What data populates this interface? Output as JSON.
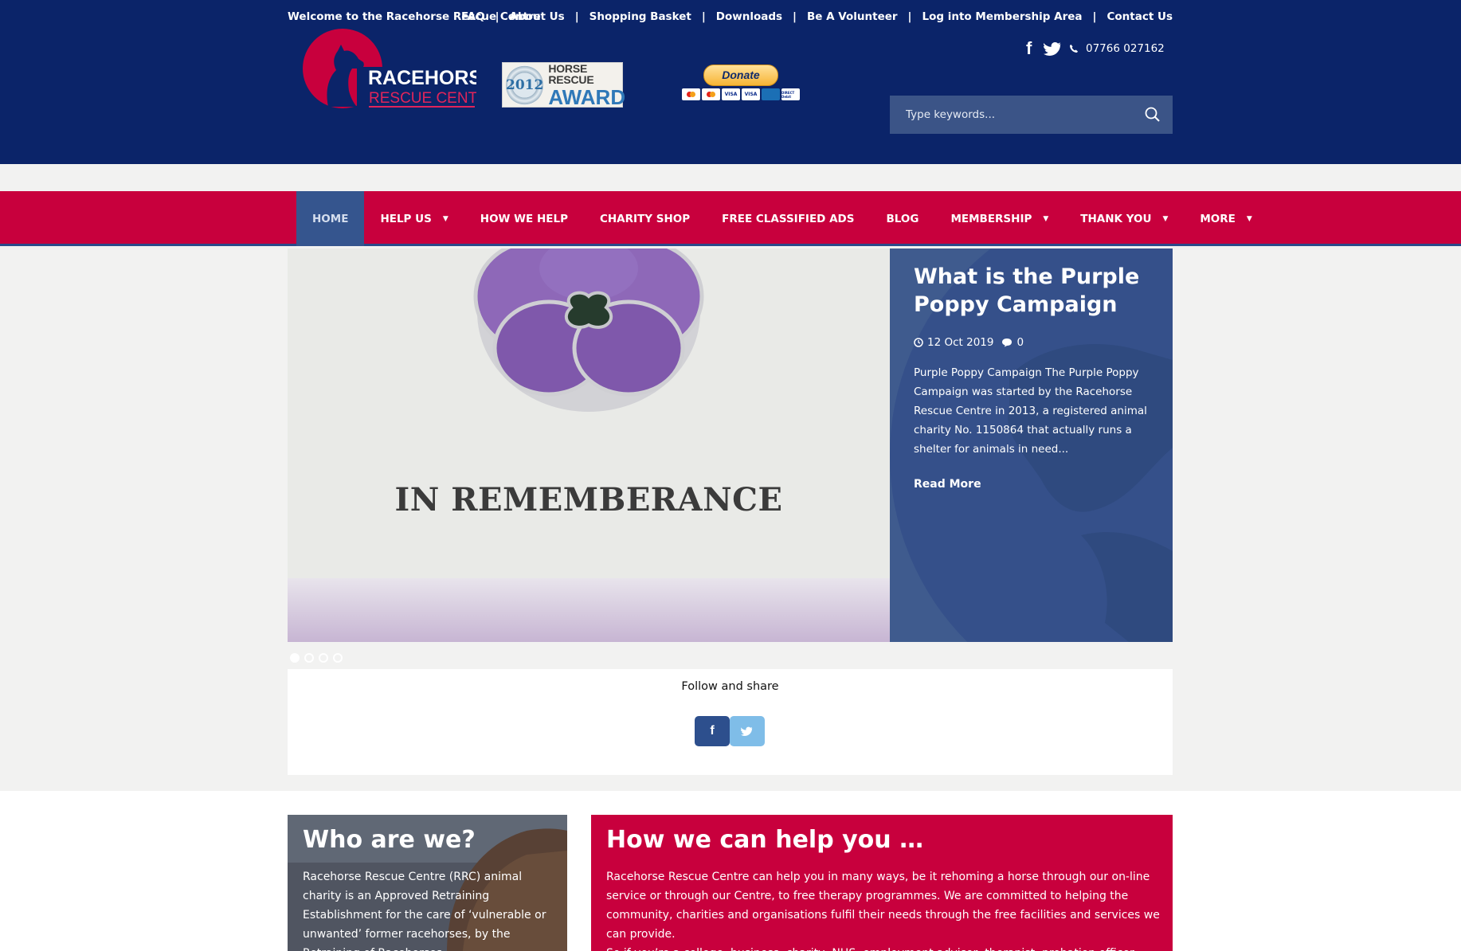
{
  "header": {
    "welcome": "Welcome to the Racehorse Rescue Centre",
    "links": [
      "FAQ",
      "About Us",
      "Shopping Basket",
      "Downloads",
      "Be A Volunteer",
      "Log into Membership Area",
      "Contact Us"
    ],
    "separator": "|",
    "logo": {
      "line1": "RACEHORSE",
      "line2": "RESCUE CENTRE"
    },
    "award": {
      "year": "2012",
      "line1": "HORSE RESCUE",
      "line2": "AWARD"
    },
    "donate_label": "Donate",
    "cards": [
      "VISA",
      "VISA",
      "DIRECT Debit"
    ],
    "facebook_glyph": "f",
    "phone": "07766 027162",
    "search_placeholder": "Type keywords..."
  },
  "nav": {
    "items": [
      {
        "label": "HOME",
        "active": true,
        "dropdown": false
      },
      {
        "label": "HELP US",
        "dropdown": true
      },
      {
        "label": "HOW WE HELP",
        "dropdown": false
      },
      {
        "label": "CHARITY SHOP",
        "dropdown": false
      },
      {
        "label": "FREE CLASSIFIED ADS",
        "dropdown": false
      },
      {
        "label": "BLOG",
        "dropdown": false
      },
      {
        "label": "MEMBERSHIP",
        "dropdown": true
      },
      {
        "label": "THANK YOU",
        "dropdown": true
      },
      {
        "label": "MORE",
        "dropdown": true
      }
    ]
  },
  "slider": {
    "image_text": "IN REMEMBERANCE",
    "title": "What is the Purple Poppy Campaign",
    "date": "12 Oct 2019",
    "comments": "0",
    "excerpt": "Purple Poppy Campaign The Purple Poppy Campaign was started by the Racehorse Rescue Centre in 2013, a registered animal charity No. 1150864 that actually runs a shelter for animals in need...",
    "read_more": "Read More",
    "slide_count": 4,
    "active_slide": 1
  },
  "share": {
    "label": "Follow and share",
    "facebook": "f"
  },
  "who": {
    "title": "Who are we?",
    "text": "Racehorse Rescue Centre (RRC) animal charity is an Approved Retraining Establishment for the care of ‘vulnerable or unwanted’ former racehorses, by the Retraining of Racehorses"
  },
  "howhelp": {
    "title": "How we can help you …",
    "p1": "Racehorse Rescue Centre can help you in many ways, be it rehoming a horse through our on-line service or through our Centre, to free therapy programmes. We are committed to helping the community, charities and organisations fulfil their needs through the free facilities and services we can provide.",
    "p2": "So if you’re a college, business, charity, NHS, employment advisor, therapist, probation officer, veteran"
  },
  "colors": {
    "header_bg": "#0b2469",
    "nav_bg": "#c8003d",
    "nav_active": "#35558e",
    "panel_bg": "#3f5b8e",
    "brand_red": "#c8003d"
  }
}
